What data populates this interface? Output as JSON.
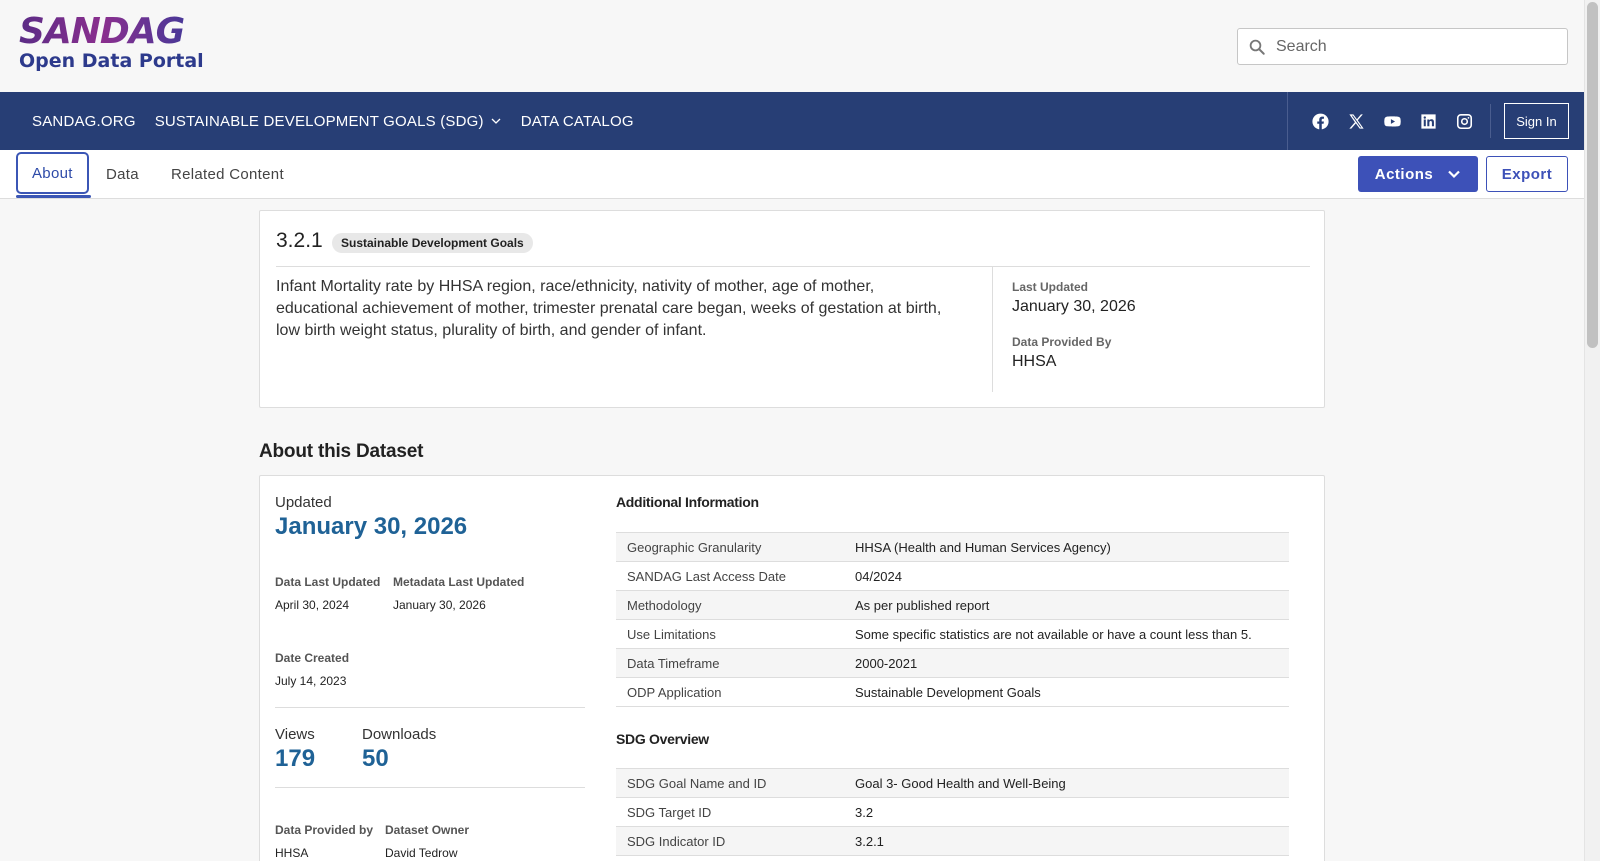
{
  "header": {
    "logo_main": "SANDAG",
    "logo_sub": "Open Data Portal",
    "search_placeholder": "Search"
  },
  "nav": {
    "items": [
      "SANDAG.ORG",
      "SUSTAINABLE DEVELOPMENT GOALS (SDG)",
      "DATA CATALOG"
    ],
    "social_icons": [
      "facebook-icon",
      "x-icon",
      "youtube-icon",
      "linkedin-icon",
      "instagram-icon"
    ],
    "sign_in": "Sign In"
  },
  "tabs": {
    "items": [
      "About",
      "Data",
      "Related Content"
    ],
    "active": "About",
    "actions_label": "Actions",
    "export_label": "Export"
  },
  "summary": {
    "id": "3.2.1",
    "badge": "Sustainable Development Goals",
    "description": "Infant Mortality rate by HHSA region, race/ethnicity, nativity of mother, age of mother, educational achievement of mother, trimester prenatal care began, weeks of gestation at birth, low birth weight status, plurality of birth, and gender of infant.",
    "last_updated_label": "Last Updated",
    "last_updated": "January 30, 2026",
    "provided_by_label": "Data Provided By",
    "provided_by": "HHSA"
  },
  "about": {
    "heading": "About this Dataset",
    "updated_label": "Updated",
    "updated": "January 30, 2026",
    "data_last_updated_label": "Data Last Updated",
    "data_last_updated": "April 30, 2024",
    "metadata_last_updated_label": "Metadata Last Updated",
    "metadata_last_updated": "January 30, 2026",
    "date_created_label": "Date Created",
    "date_created": "July 14, 2023",
    "views_label": "Views",
    "views": "179",
    "downloads_label": "Downloads",
    "downloads": "50",
    "provided_by_label": "Data Provided by",
    "provided_by": "HHSA",
    "owner_label": "Dataset Owner",
    "owner": "David Tedrow"
  },
  "additional_info": {
    "heading": "Additional Information",
    "rows": [
      {
        "key": "Geographic Granularity",
        "value": "HHSA (Health and Human Services Agency)"
      },
      {
        "key": "SANDAG Last Access Date",
        "value": "04/2024"
      },
      {
        "key": "Methodology",
        "value": "As per published report"
      },
      {
        "key": "Use Limitations",
        "value": "Some specific statistics are not available or have a count less than 5."
      },
      {
        "key": "Data Timeframe",
        "value": "2000-2021"
      },
      {
        "key": "ODP Application",
        "value": "Sustainable Development Goals"
      }
    ]
  },
  "sdg_overview": {
    "heading": "SDG Overview",
    "rows": [
      {
        "key": "SDG Goal Name and ID",
        "value": "Goal 3- Good Health and Well-Being"
      },
      {
        "key": "SDG Target ID",
        "value": "3.2"
      },
      {
        "key": "SDG Indicator ID",
        "value": "3.2.1"
      }
    ]
  }
}
